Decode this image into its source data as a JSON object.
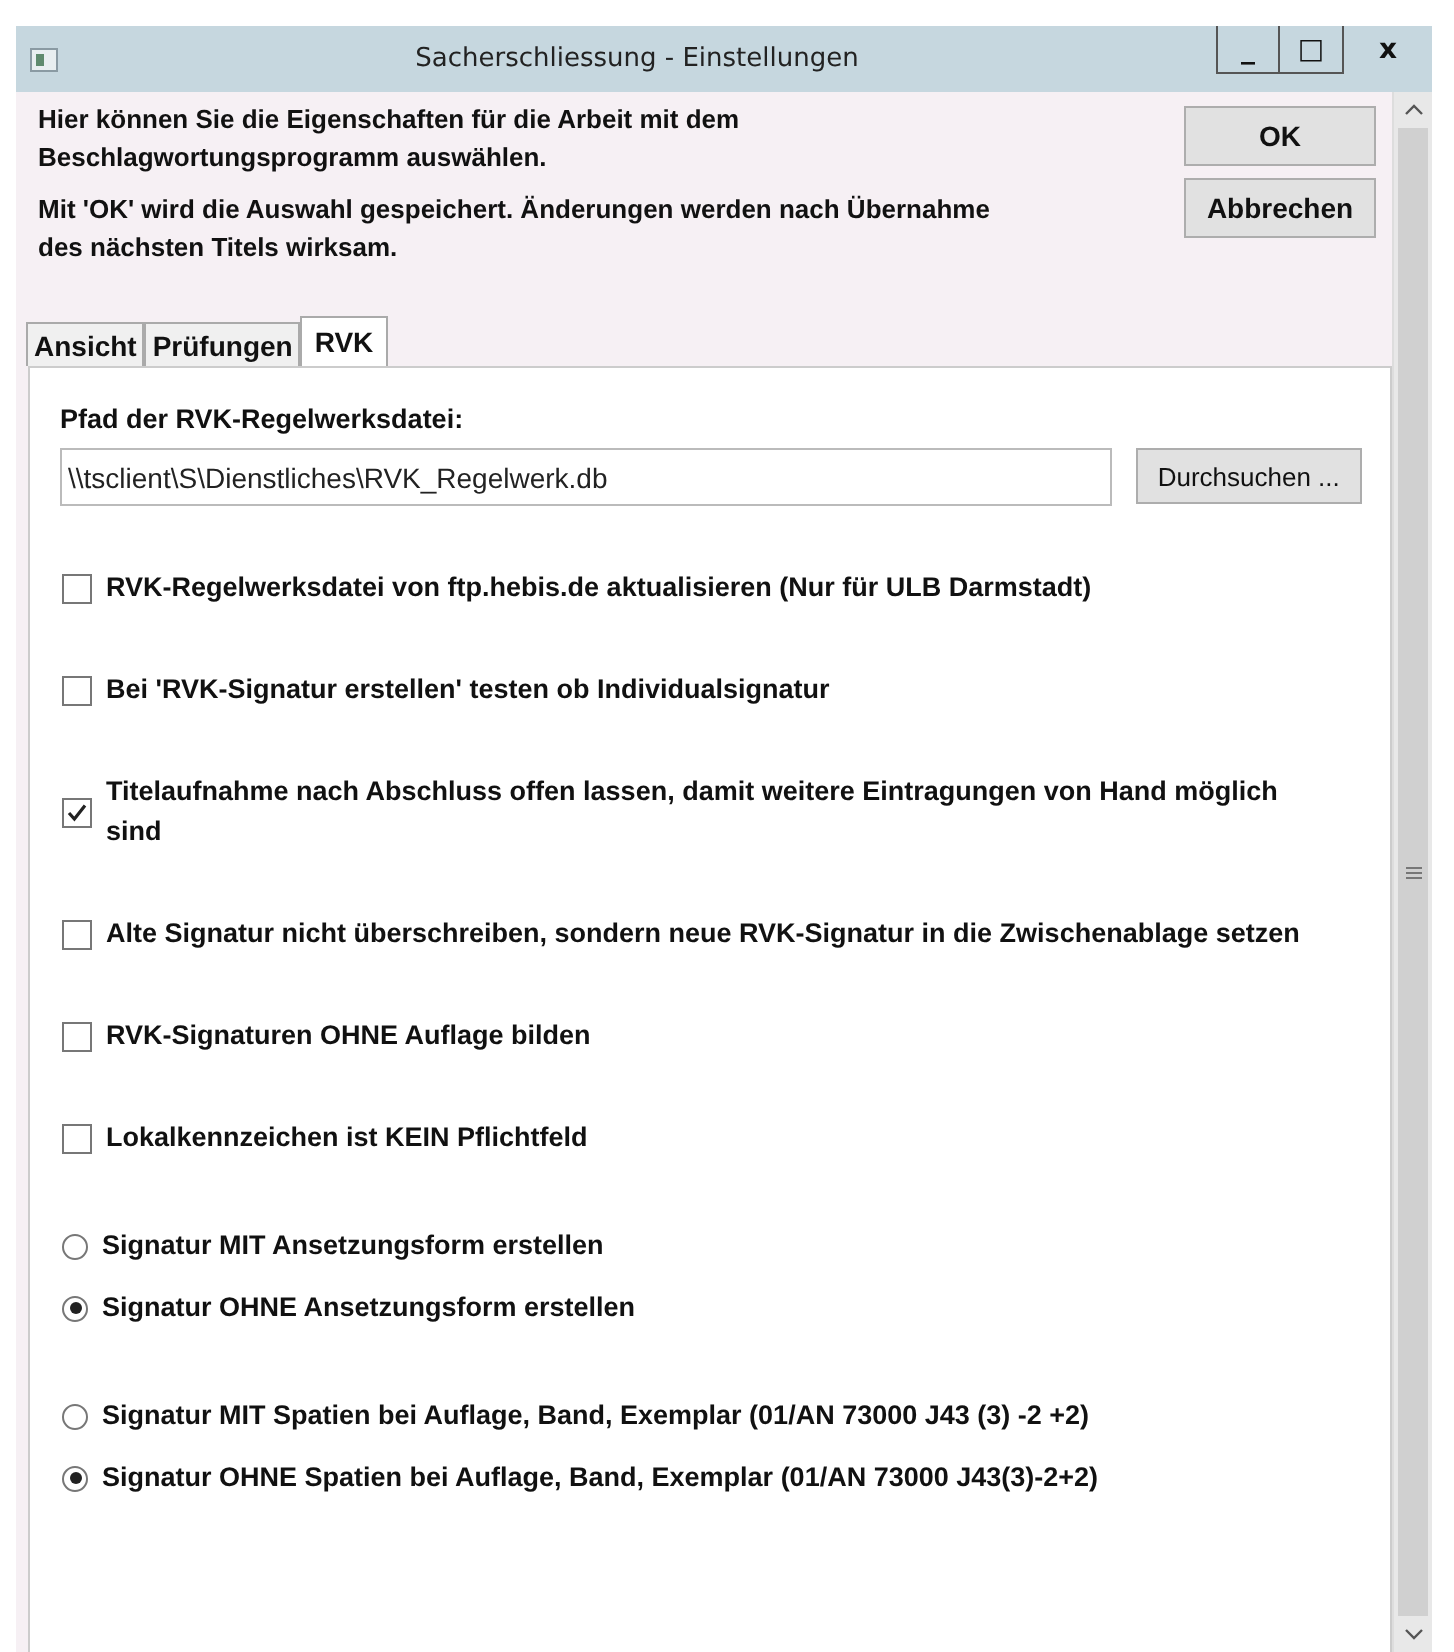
{
  "window": {
    "title": "Sacherschliessung - Einstellungen",
    "controls": [
      "_",
      "□",
      "x"
    ]
  },
  "intro": [
    "Hier können Sie die Eigenschaften für die Arbeit mit dem Beschlagwortungsprogramm auswählen.",
    "Mit 'OK' wird die Auswahl gespeichert. Änderungen werden nach Übernahme des nächsten Titels wirksam."
  ],
  "buttons": [
    "OK",
    "Abbrechen"
  ],
  "tabs": [
    {
      "label": "Ansicht",
      "selected": false
    },
    {
      "label": "Prüfungen",
      "selected": false
    },
    {
      "label": "RVK",
      "selected": true
    }
  ],
  "path": {
    "label": "Pfad der RVK-Regelwerksdatei:",
    "value": "\\\\tsclient\\S\\Dienstliches\\RVK_Regelwerk.db",
    "browse": "Durchsuchen ..."
  },
  "checkboxes": [
    {
      "label": "RVK-Regelwerksdatei von ftp.hebis.de aktualisieren (Nur für ULB Darmstadt)",
      "checked": false
    },
    {
      "label": "Bei 'RVK-Signatur erstellen' testen ob Individualsignatur",
      "checked": false
    },
    {
      "label": "Titelaufnahme nach Abschluss offen lassen, damit weitere Eintragungen von Hand möglich sind",
      "checked": true
    },
    {
      "label": "Alte Signatur nicht überschreiben, sondern neue RVK-Signatur in die Zwischenablage setzen",
      "checked": false
    },
    {
      "label": "RVK-Signaturen OHNE Auflage bilden",
      "checked": false
    },
    {
      "label": "Lokalkennzeichen ist KEIN Pflichtfeld",
      "checked": false
    }
  ],
  "radio_groups": [
    [
      {
        "label": "Signatur MIT Ansetzungsform erstellen",
        "selected": false
      },
      {
        "label": "Signatur OHNE Ansetzungsform erstellen",
        "selected": true
      }
    ],
    [
      {
        "label": "Signatur MIT Spatien bei Auflage, Band, Exemplar (01/AN 73000 J43 (3) -2 +2)",
        "selected": false
      },
      {
        "label": "Signatur OHNE Spatien bei Auflage, Band, Exemplar (01/AN 73000 J43(3)-2+2)",
        "selected": true
      }
    ]
  ]
}
